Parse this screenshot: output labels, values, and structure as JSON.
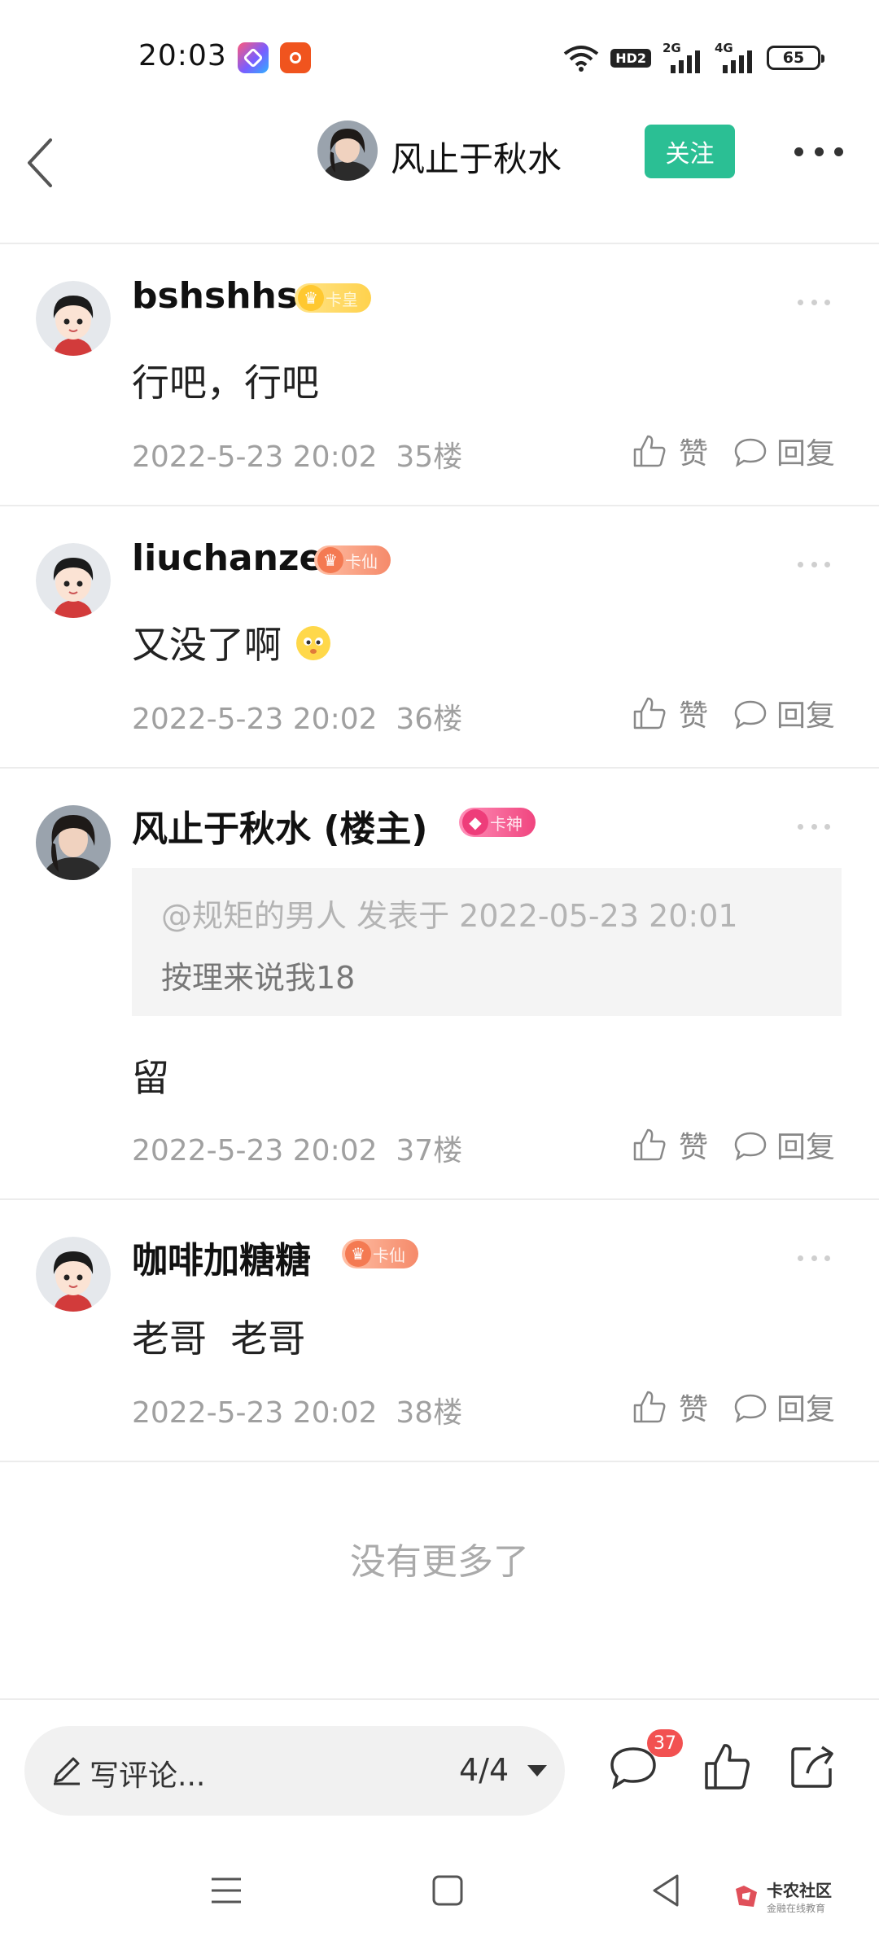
{
  "status_bar": {
    "time": "20:03",
    "hd_label": "HD2",
    "net1_label": "2G",
    "net2_label": "4G",
    "battery": "65"
  },
  "header": {
    "author_name": "风止于秋水",
    "follow_label": "关注"
  },
  "comments": [
    {
      "username": "bshshhs",
      "badge": "卡皇",
      "text": "行吧，行吧",
      "datetime": "2022-5-23 20:02",
      "floor": "35楼",
      "like_label": "赞",
      "reply_label": "回复"
    },
    {
      "username": "liuchanze",
      "badge": "卡仙",
      "text": "又没了啊",
      "datetime": "2022-5-23 20:02",
      "floor": "36楼",
      "like_label": "赞",
      "reply_label": "回复"
    },
    {
      "username": "风止于秋水 (楼主)",
      "badge": "卡神",
      "quote_head": "@规矩的男人 发表于 2022-05-23 20:01",
      "quote_body": "按理来说我18",
      "text": "留",
      "datetime": "2022-5-23 20:02",
      "floor": "37楼",
      "like_label": "赞",
      "reply_label": "回复"
    },
    {
      "username": "咖啡加糖糖",
      "badge": "卡仙",
      "text": "老哥  老哥",
      "datetime": "2022-5-23 20:02",
      "floor": "38楼",
      "like_label": "赞",
      "reply_label": "回复"
    }
  ],
  "no_more_text": "没有更多了",
  "bottom_bar": {
    "comment_placeholder": "写评论...",
    "page_indicator": "4/4",
    "comment_count": "37"
  },
  "watermark": {
    "title": "卡农社区",
    "subtitle": "金融在线教育"
  },
  "colors": {
    "accent_green": "#2bbf94",
    "badge_red": "#f25151"
  }
}
